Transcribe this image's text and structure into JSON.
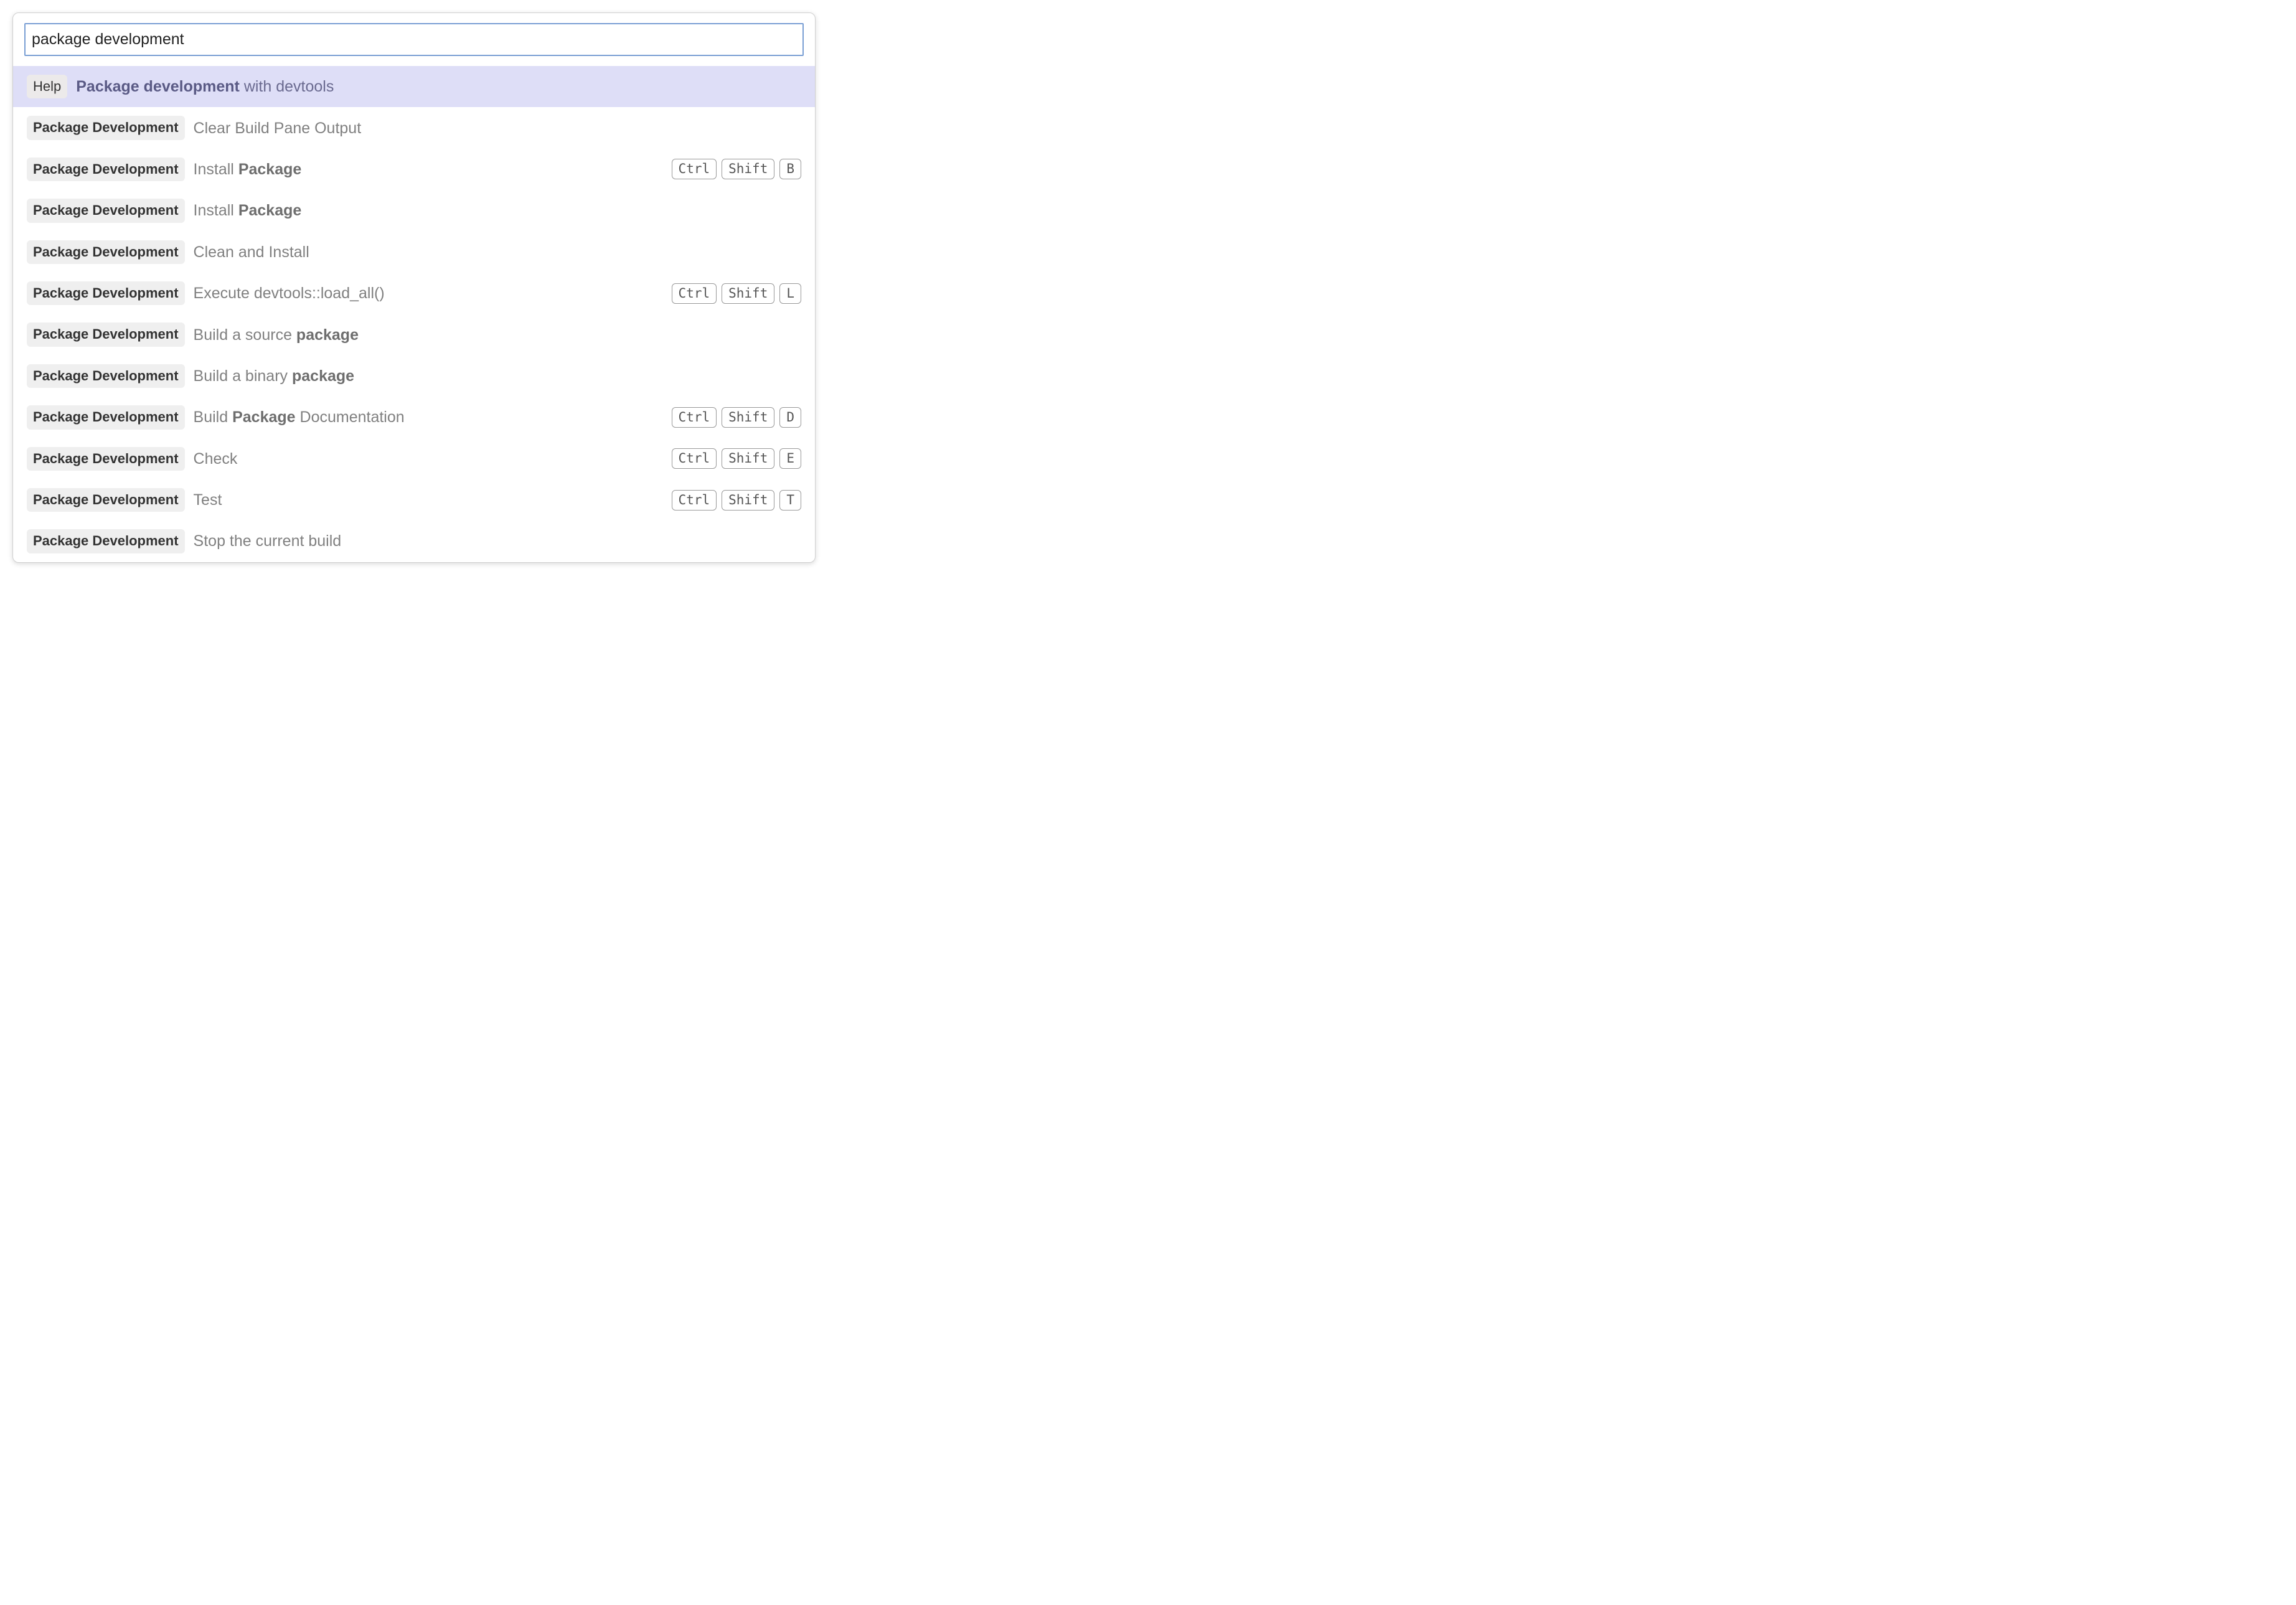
{
  "search": {
    "value": "package development"
  },
  "results": [
    {
      "category": "Help",
      "label_html": "<b>Package development</b> with devtools",
      "selected": true,
      "shortcut": []
    },
    {
      "category": "Package Development",
      "label_html": "Clear Build Pane Output",
      "selected": false,
      "shortcut": []
    },
    {
      "category": "Package Development",
      "label_html": "Install <b>Package</b>",
      "selected": false,
      "shortcut": [
        "Ctrl",
        "Shift",
        "B"
      ]
    },
    {
      "category": "Package Development",
      "label_html": "Install <b>Package</b>",
      "selected": false,
      "shortcut": []
    },
    {
      "category": "Package Development",
      "label_html": "Clean and Install",
      "selected": false,
      "shortcut": []
    },
    {
      "category": "Package Development",
      "label_html": "Execute devtools::load_all()",
      "selected": false,
      "shortcut": [
        "Ctrl",
        "Shift",
        "L"
      ]
    },
    {
      "category": "Package Development",
      "label_html": "Build a source <b>package</b>",
      "selected": false,
      "shortcut": []
    },
    {
      "category": "Package Development",
      "label_html": "Build a binary <b>package</b>",
      "selected": false,
      "shortcut": []
    },
    {
      "category": "Package Development",
      "label_html": "Build <b>Package</b> Documentation",
      "selected": false,
      "shortcut": [
        "Ctrl",
        "Shift",
        "D"
      ]
    },
    {
      "category": "Package Development",
      "label_html": "Check",
      "selected": false,
      "shortcut": [
        "Ctrl",
        "Shift",
        "E"
      ]
    },
    {
      "category": "Package Development",
      "label_html": "Test",
      "selected": false,
      "shortcut": [
        "Ctrl",
        "Shift",
        "T"
      ]
    },
    {
      "category": "Package Development",
      "label_html": "Stop the current build",
      "selected": false,
      "shortcut": []
    }
  ]
}
